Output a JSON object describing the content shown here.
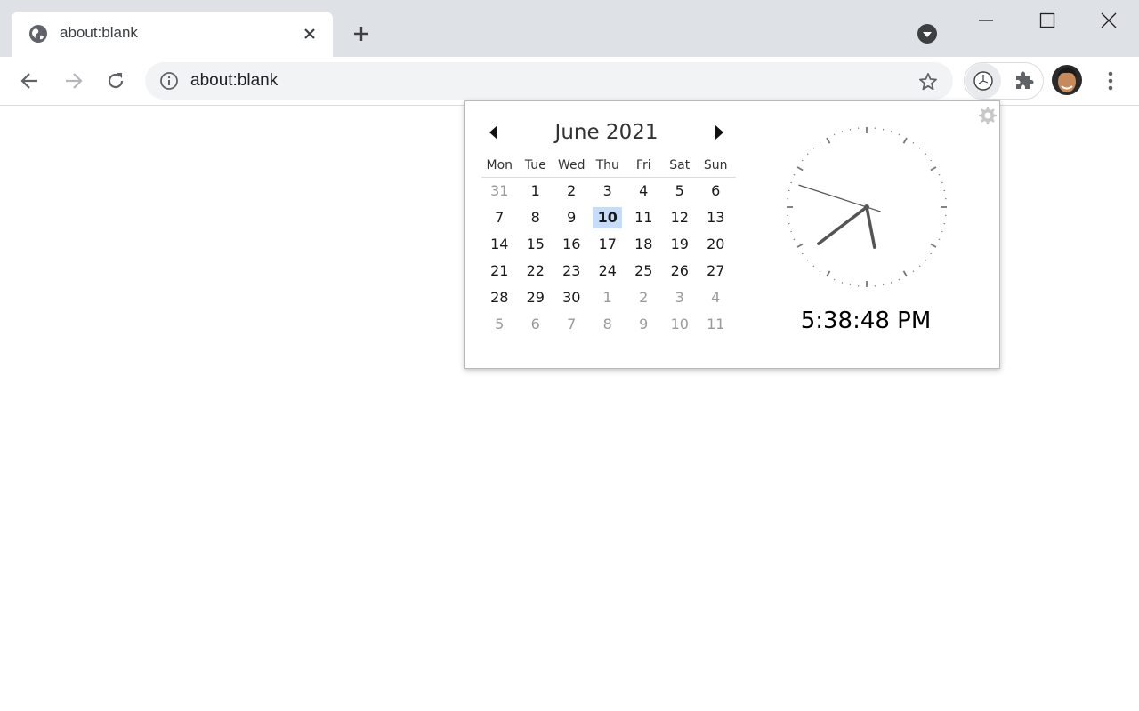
{
  "tab": {
    "title": "about:blank"
  },
  "omnibox": {
    "url": "about:blank"
  },
  "calendar": {
    "month_label": "June 2021",
    "weekdays": [
      "Mon",
      "Tue",
      "Wed",
      "Thu",
      "Fri",
      "Sat",
      "Sun"
    ],
    "weeks": [
      [
        {
          "d": "31",
          "o": true
        },
        {
          "d": "1"
        },
        {
          "d": "2"
        },
        {
          "d": "3"
        },
        {
          "d": "4"
        },
        {
          "d": "5"
        },
        {
          "d": "6"
        }
      ],
      [
        {
          "d": "7"
        },
        {
          "d": "8"
        },
        {
          "d": "9"
        },
        {
          "d": "10",
          "today": true
        },
        {
          "d": "11"
        },
        {
          "d": "12"
        },
        {
          "d": "13"
        }
      ],
      [
        {
          "d": "14"
        },
        {
          "d": "15"
        },
        {
          "d": "16"
        },
        {
          "d": "17"
        },
        {
          "d": "18"
        },
        {
          "d": "19"
        },
        {
          "d": "20"
        }
      ],
      [
        {
          "d": "21"
        },
        {
          "d": "22"
        },
        {
          "d": "23"
        },
        {
          "d": "24"
        },
        {
          "d": "25"
        },
        {
          "d": "26"
        },
        {
          "d": "27"
        }
      ],
      [
        {
          "d": "28"
        },
        {
          "d": "29"
        },
        {
          "d": "30"
        },
        {
          "d": "1",
          "o": true
        },
        {
          "d": "2",
          "o": true
        },
        {
          "d": "3",
          "o": true
        },
        {
          "d": "4",
          "o": true
        }
      ],
      [
        {
          "d": "5",
          "o": true
        },
        {
          "d": "6",
          "o": true
        },
        {
          "d": "7",
          "o": true
        },
        {
          "d": "8",
          "o": true
        },
        {
          "d": "9",
          "o": true
        },
        {
          "d": "10",
          "o": true
        },
        {
          "d": "11",
          "o": true
        }
      ]
    ]
  },
  "clock": {
    "digital": "5:38:48 PM",
    "hours": 5,
    "minutes": 38,
    "seconds": 48
  },
  "colors": {
    "today_highlight": "#c6dcfb",
    "hand": "#555555",
    "chrome_frame": "#dee1e6"
  }
}
